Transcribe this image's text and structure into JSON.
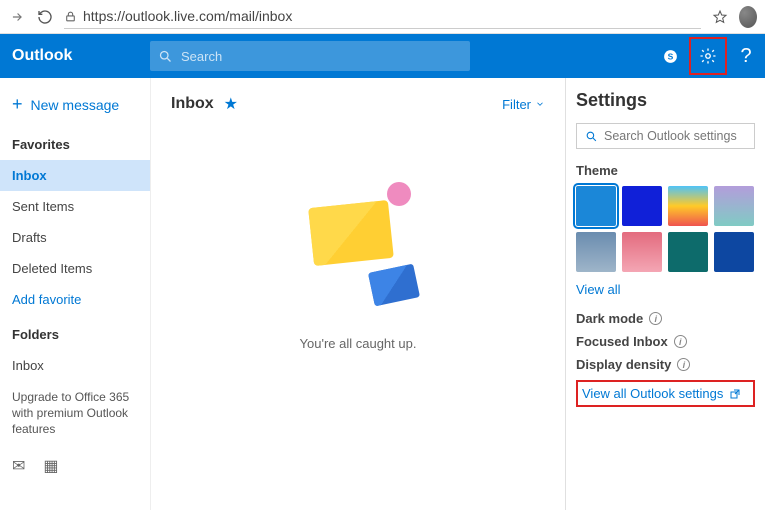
{
  "browser": {
    "url": "https://outlook.live.com/mail/inbox"
  },
  "header": {
    "brand": "Outlook",
    "search_placeholder": "Search"
  },
  "sidebar": {
    "new_message": "New message",
    "favorites_header": "Favorites",
    "favorites": [
      {
        "label": "Inbox",
        "active": true
      },
      {
        "label": "Sent Items"
      },
      {
        "label": "Drafts"
      },
      {
        "label": "Deleted Items"
      }
    ],
    "add_favorite": "Add favorite",
    "folders_header": "Folders",
    "folders": [
      {
        "label": "Inbox"
      }
    ],
    "upgrade_text": "Upgrade to Office 365 with premium Outlook features"
  },
  "main": {
    "title": "Inbox",
    "filter_label": "Filter",
    "empty_text": "You're all caught up."
  },
  "settings": {
    "title": "Settings",
    "search_placeholder": "Search Outlook settings",
    "theme_label": "Theme",
    "themes": [
      {
        "css": "background:#1b87d8",
        "selected": true
      },
      {
        "css": "background:#1020d8"
      },
      {
        "css": "background:linear-gradient(180deg,#4fc3f7,#ffca28 50%,#ef5350)"
      },
      {
        "css": "background:linear-gradient(180deg,#b39ddb,#80cbc4)"
      },
      {
        "css": "background:linear-gradient(180deg,#6a8caf,#9eb5c9)"
      },
      {
        "css": "background:linear-gradient(180deg,#e36b7e,#f4a6b4)"
      },
      {
        "css": "background:#0d6b6b"
      },
      {
        "css": "background:#0d47a1"
      }
    ],
    "view_all": "View all",
    "dark_mode": "Dark mode",
    "focused_inbox": "Focused Inbox",
    "display_density": "Display density",
    "view_all_settings": "View all Outlook settings"
  }
}
